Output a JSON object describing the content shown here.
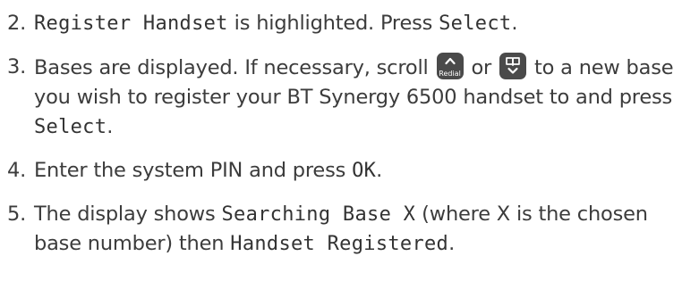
{
  "steps": [
    {
      "number": "2.",
      "seg1": "Register Handset",
      "seg2": " is highlighted. Press ",
      "seg3": "Select",
      "seg4": "."
    },
    {
      "number": "3.",
      "seg1": "Bases are displayed. If necessary, scroll ",
      "key_redial_label": "Redial",
      "seg2": " or ",
      "seg3": " to a new base you wish to register your BT Synergy 6500 handset to and press ",
      "seg4": "Select",
      "seg5": "."
    },
    {
      "number": "4.",
      "seg1": "Enter the system PIN and press ",
      "seg2": "OK",
      "seg3": "."
    },
    {
      "number": "5.",
      "seg1": "The display shows ",
      "seg2": "Searching Base X",
      "seg3": " (where X is the chosen base number) then ",
      "seg4": "Handset Registered",
      "seg5": "."
    }
  ],
  "icons": {
    "redial_key": "redial-up-arrow-icon",
    "phonebook_key": "phonebook-down-arrow-icon",
    "key_background": "#4a4a4a",
    "text_color": "#3c3c3c"
  }
}
